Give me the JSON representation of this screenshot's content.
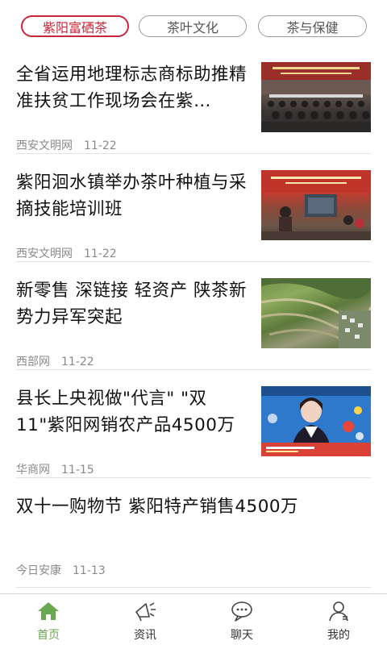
{
  "tabs": [
    {
      "label": "紫阳富硒茶",
      "active": true
    },
    {
      "label": "茶叶文化",
      "active": false
    },
    {
      "label": "茶与保健",
      "active": false
    }
  ],
  "feed": [
    {
      "title": "全省运用地理标志商标助推精准扶贫工作现场会在紫…",
      "source": "西安文明网",
      "date": "11-22",
      "thumb": "meeting-photo"
    },
    {
      "title": "紫阳洄水镇举办茶叶种植与采摘技能培训班",
      "source": "西安文明网",
      "date": "11-22",
      "thumb": "training-photo"
    },
    {
      "title": "新零售 深链接 轻资产 陕茶新势力异军突起",
      "source": "西部网",
      "date": "11-22",
      "thumb": "tea-terrace-photo"
    },
    {
      "title": "县长上央视做\"代言\" \"双11\"紫阳网销农产品4500万",
      "source": "华商网",
      "date": "11-15",
      "thumb": "tv-broadcast-photo"
    },
    {
      "title": "双十一购物节 紫阳特产销售4500万",
      "source": "今日安康",
      "date": "11-13",
      "thumb": null
    }
  ],
  "nav": [
    {
      "label": "首页",
      "icon": "home-icon",
      "active": true
    },
    {
      "label": "资讯",
      "icon": "megaphone-icon",
      "active": false
    },
    {
      "label": "聊天",
      "icon": "chat-icon",
      "active": false
    },
    {
      "label": "我的",
      "icon": "user-icon",
      "active": false
    }
  ],
  "colors": {
    "accent": "#c8283a",
    "nav_active": "#6aa84f"
  }
}
